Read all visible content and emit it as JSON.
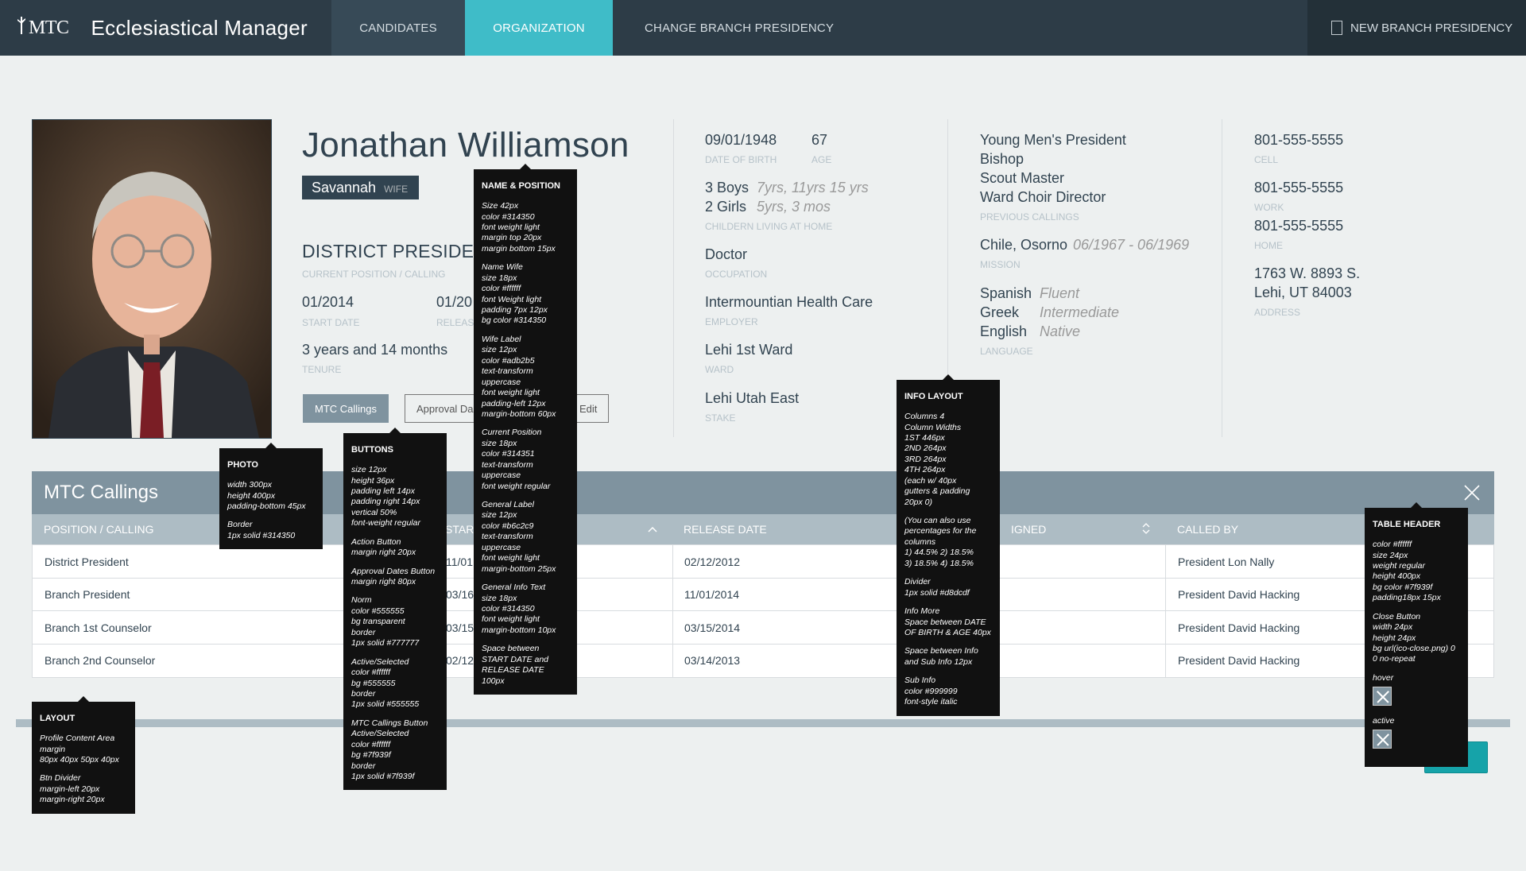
{
  "app": {
    "logo": "MTC",
    "title": "Ecclesiastical  Manager"
  },
  "nav": {
    "tabs": [
      {
        "label": "CANDIDATES"
      },
      {
        "label": "ORGANIZATION"
      },
      {
        "label": "CHANGE BRANCH PRESIDENCY"
      }
    ],
    "new_branch": "NEW BRANCH PRESIDENCY"
  },
  "profile": {
    "name": "Jonathan Williamson",
    "wife_name": "Savannah",
    "wife_label": "WIFE",
    "position": "DISTRICT PRESIDENT",
    "position_label": "CURRENT POSITION / CALLING",
    "start_date": "01/2014",
    "start_label": "START DATE",
    "release_date": "01/20",
    "release_label": "RELEASE",
    "tenure": "3 years and 14 months",
    "tenure_label": "TENURE",
    "buttons": {
      "calls": "MTC Callings",
      "approval": "Approval Da",
      "edit": "Edit"
    }
  },
  "info": {
    "dob": "09/01/1948",
    "dob_label": "DATE OF BIRTH",
    "age": "67",
    "age_label": "AGE",
    "boys": "3 Boys",
    "boys_ages": "7yrs, 11yrs 15 yrs",
    "girls": "2 Girls",
    "girls_ages": "5yrs, 3 mos",
    "children_label": "CHILDERN LIVING AT HOME",
    "occupation": "Doctor",
    "occupation_label": "OCCUPATION",
    "employer": "Intermountian Health Care",
    "employer_label": "EMPLOYER",
    "ward": "Lehi 1st Ward",
    "ward_label": "WARD",
    "stake": "Lehi Utah East",
    "stake_label": "STAKE",
    "previous_callings": [
      "Young Men's President",
      "Bishop",
      "Scout Master",
      "Ward Choir Director"
    ],
    "previous_label": "PREVIOUS CALLINGS",
    "mission": "Chile, Osorno",
    "mission_dates": "06/1967 - 06/1969",
    "mission_label": "MISSION",
    "languages": [
      {
        "name": "Spanish",
        "level": "Fluent"
      },
      {
        "name": "Greek",
        "level": "Intermediate"
      },
      {
        "name": "English",
        "level": "Native"
      }
    ],
    "language_label": "LANGUAGE",
    "cell": "801-555-5555",
    "cell_label": "CELL",
    "work": "801-555-5555",
    "work_label": "WORK",
    "home": "801-555-5555",
    "home_label": "HOME",
    "address1": "1763 W. 8893 S.",
    "address2": "Lehi, UT 84003",
    "address_label": "ADDRESS"
  },
  "table": {
    "title": "MTC Callings",
    "headers": [
      "POSITION / CALLING",
      "STAR",
      "RELEASE DATE",
      "IGNED",
      "CALLED BY"
    ],
    "rows": [
      {
        "position": "District President",
        "start": "11/01",
        "release": "02/12/2012",
        "called_by": "President Lon Nally"
      },
      {
        "position": "Branch President",
        "start": "03/16",
        "release": "11/01/2014",
        "called_by": "President David Hacking"
      },
      {
        "position": "Branch 1st Counselor",
        "start": "03/15",
        "release": "03/15/2014",
        "called_by": "President David Hacking"
      },
      {
        "position": "Branch 2nd Counselor",
        "start": "02/12",
        "release": "03/14/2013",
        "called_by": "President David Hacking"
      }
    ]
  },
  "notes": {
    "photo": {
      "title": "PHOTO",
      "lines": [
        "width  300px",
        "height  400px",
        "padding-bottom 45px",
        "",
        "Border",
        "1px solid #314350"
      ]
    },
    "layout": {
      "title": "LAYOUT",
      "lines": [
        "Profile Content Area",
        "margin",
        "80px 40px 50px 40px",
        "",
        "Btn Divider",
        "margin-left  20px",
        "margin-right  20px"
      ]
    },
    "buttons": {
      "title": "BUTTONS",
      "lines": [
        "size 12px",
        "height 36px",
        "padding left 14px",
        "padding right 14px",
        "vertical 50%",
        "font-weight regular",
        "",
        "Action Button",
        "margin right 20px",
        "",
        "Approval Dates Button",
        "margin right 80px",
        "",
        "Norm",
        "color #555555",
        "bg transparent",
        "border",
        "1px solid #777777",
        "",
        "Active/Selected",
        "color #ffffff",
        "bg #555555",
        "border",
        "1px solid #555555",
        "",
        "MTC Callings Button",
        "Active/Selected",
        "color #ffffff",
        "bg #7f939f",
        "border",
        "1px solid #7f939f"
      ]
    },
    "name": {
      "title": "NAME & POSITION",
      "lines": [
        "Size 42px",
        "color #314350",
        "font weight light",
        "margin top 20px",
        "margin bottom 15px",
        "",
        "Name Wife",
        "size 18px",
        "color #ffffff",
        "font Weight light",
        "padding 7px 12px",
        "bg color #314350",
        "",
        "Wife Label",
        "size 12px",
        "color #adb2b5",
        "text-transform",
        "uppercase",
        "font weight light",
        "padding-left 12px",
        "margin-bottom 60px",
        "",
        "Current Position",
        "size 18px",
        "color #314351",
        "text-transform",
        "uppercase",
        "font weight regular",
        "",
        "General Label",
        "size 12px",
        "color #b6c2c9",
        "text-transform",
        "uppercase",
        "font weight light",
        "margin-bottom 25px",
        "",
        "General Info Text",
        "size 18px",
        "color #314350",
        "font weight light",
        "margin-bottom 10px",
        "",
        "Space between",
        "START DATE and",
        "RELEASE DATE 100px"
      ]
    },
    "info": {
      "title": "INFO LAYOUT",
      "lines": [
        "Columns 4",
        "Column Widths",
        "1ST  446px",
        "2ND  264px",
        "3RD 264px",
        "4TH 264px",
        "(each  w/ 40px",
        "gutters & padding",
        "20px 0)",
        "",
        "(You can also use",
        "percentages for the",
        "columns",
        "1) 44.5%  2) 18.5%",
        "3) 18.5%  4) 18.5%",
        "",
        "Divider",
        "1px solid #d8dcdf",
        "",
        "Info More",
        "Space between DATE",
        "OF BIRTH & AGE 40px",
        "",
        "Space between  Info",
        "and Sub Info 12px",
        "",
        "Sub Info",
        "color #999999",
        "font-style italic"
      ]
    },
    "header": {
      "title": "TABLE HEADER",
      "lines": [
        "color  #ffffff",
        "size  24px",
        "weight  regular",
        "height  400px",
        "bg color #7f939f",
        "padding18px 15px",
        "",
        "Close Button",
        "width 24px",
        "height 24px",
        "bg url(ico-close.png) 0",
        "0 no-repeat",
        "",
        "hover"
      ],
      "active_label": "active"
    }
  }
}
